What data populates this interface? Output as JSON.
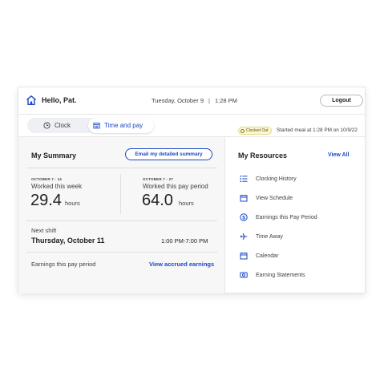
{
  "header": {
    "greeting": "Hello, Pat.",
    "date": "Tuesday, October 9",
    "time": "1:28 PM",
    "logout_label": "Logout"
  },
  "tabs": [
    {
      "label": "Clock",
      "icon": "clock-icon",
      "active": false
    },
    {
      "label": "Time and pay",
      "icon": "calendar-icon",
      "active": true
    }
  ],
  "status": {
    "badge": "Clocked Out",
    "text": "Started meal at 1:28 PM on 10/9/22"
  },
  "summary": {
    "title": "My Summary",
    "email_button": "Email my detailed summary",
    "week": {
      "range": "OCTOBER 7 - 14",
      "label": "Worked this week",
      "value": "29.4",
      "unit": "hours"
    },
    "period": {
      "range": "OCTOBER 7 - 27",
      "label": "Worked this pay period",
      "value": "64.0",
      "unit": "hours"
    },
    "next_shift_label": "Next shift",
    "next_shift_day": "Thursday, October 11",
    "next_shift_time": "1:00 PM-7:00 PM",
    "earnings_label": "Earnings this pay period",
    "accrued_link": "View accrued earnings"
  },
  "resources": {
    "title": "My Resources",
    "view_all": "View All",
    "items": [
      {
        "label": "Clocking History",
        "icon": "list-icon"
      },
      {
        "label": "View Schedule",
        "icon": "calendar-icon"
      },
      {
        "label": "Earnings this Pay Period",
        "icon": "dollar-icon"
      },
      {
        "label": "Time Away",
        "icon": "plane-icon"
      },
      {
        "label": "Calendar",
        "icon": "calendar-icon"
      },
      {
        "label": "Earning Statements",
        "icon": "statement-icon"
      }
    ]
  },
  "colors": {
    "accent": "#1a47c8",
    "status_bg": "#fbf7d6",
    "panel_bg": "#f7f7f7"
  }
}
